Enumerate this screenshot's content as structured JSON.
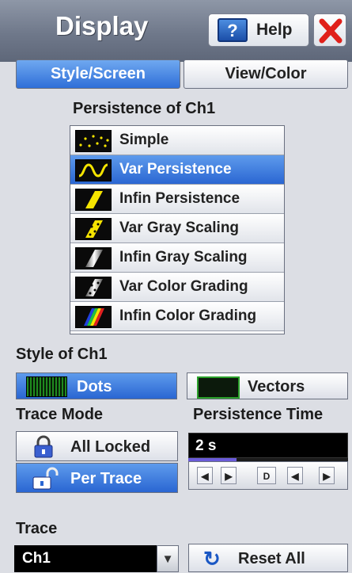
{
  "header": {
    "title": "Display",
    "help_icon": "?",
    "help_label": "Help"
  },
  "tabs": [
    {
      "label": "Style/Screen",
      "active": true
    },
    {
      "label": "View/Color",
      "active": false
    }
  ],
  "persistence": {
    "heading": "Persistence of Ch1",
    "options": [
      {
        "label": "Simple",
        "icon": "dots-icon",
        "selected": false
      },
      {
        "label": "Var Persistence",
        "icon": "wave-icon",
        "selected": true
      },
      {
        "label": "Infin Persistence",
        "icon": "slash-yellow-icon",
        "selected": false
      },
      {
        "label": "Var Gray Scaling",
        "icon": "dotted-yellow-icon",
        "selected": false
      },
      {
        "label": "Infin Gray Scaling",
        "icon": "gray-scale-icon",
        "selected": false
      },
      {
        "label": "Var Color Grading",
        "icon": "gray-dotted-icon",
        "selected": false
      },
      {
        "label": "Infin Color Grading",
        "icon": "color-grading-icon",
        "selected": false
      }
    ]
  },
  "style": {
    "heading": "Style of Ch1",
    "dots_label": "Dots",
    "vectors_label": "Vectors",
    "selected": "Dots"
  },
  "trace_mode": {
    "heading": "Trace Mode",
    "all_locked_label": "All Locked",
    "per_trace_label": "Per Trace",
    "selected": "Per Trace"
  },
  "persistence_time": {
    "heading": "Persistence Time",
    "value": "2 s",
    "level": 0.3,
    "controls": {
      "left": "◀",
      "right": "▶",
      "default": "D",
      "left2": "◀",
      "right2": "▶"
    }
  },
  "trace": {
    "heading": "Trace",
    "value": "Ch1",
    "dropdown_arrow": "▼"
  },
  "reset": {
    "icon": "↻",
    "label": "Reset All"
  },
  "colors": {
    "accent": "#2f6fd8",
    "header": "#7a8394",
    "trace_yellow": "#f5e400"
  }
}
